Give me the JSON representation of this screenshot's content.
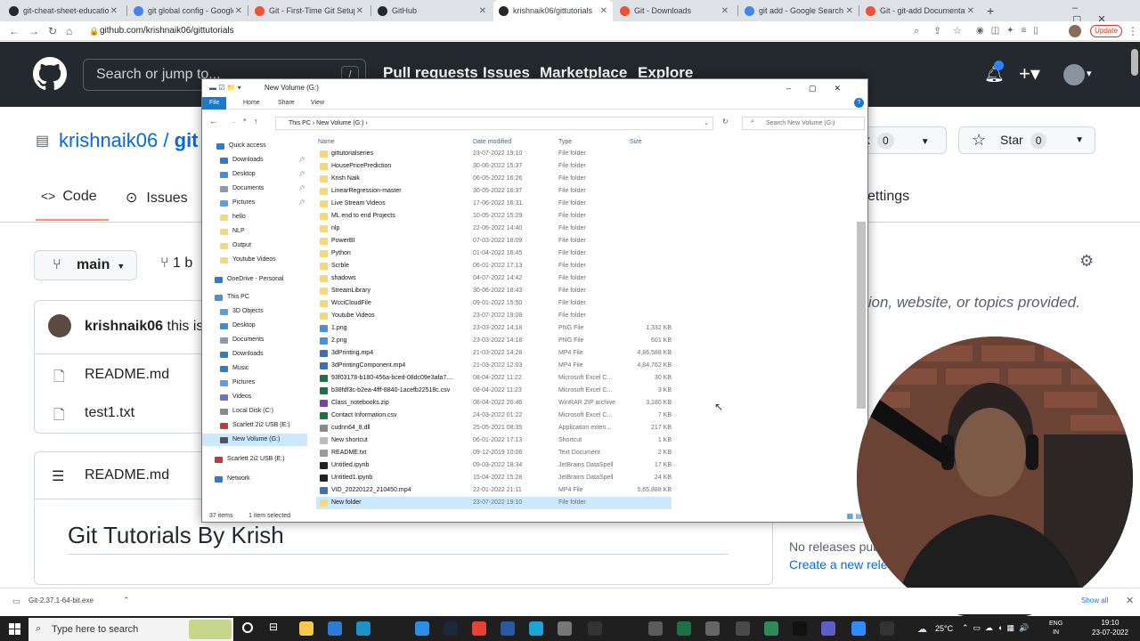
{
  "browser": {
    "tabs": [
      {
        "label": "git-cheat-sheet-education.pdf",
        "icon": "github-icon",
        "color": "#24292f"
      },
      {
        "label": "git global config - Google Search",
        "icon": "google-icon",
        "color": "#4285f4"
      },
      {
        "label": "Git - First-Time Git Setup",
        "icon": "git-icon",
        "color": "#f05133"
      },
      {
        "label": "GitHub",
        "icon": "github-icon",
        "color": "#24292f"
      },
      {
        "label": "krishnaik06/gittutorials",
        "icon": "github-icon",
        "color": "#24292f"
      },
      {
        "label": "Git - Downloads",
        "icon": "git-icon",
        "color": "#f05133"
      },
      {
        "label": "git add - Google Search",
        "icon": "google-icon",
        "color": "#4285f4"
      },
      {
        "label": "Git - git-add Documentation",
        "icon": "git-icon",
        "color": "#f05133"
      }
    ],
    "url": "github.com/krishnaik06/gittutorials",
    "update_label": "Update"
  },
  "github": {
    "search_placeholder": "Search or jump to...",
    "search_key": "/",
    "nav": [
      "Pull requests",
      "Issues",
      "Marketplace",
      "Explore"
    ],
    "owner": "krishnaik06",
    "repo_fragment": "git",
    "tabs": {
      "code": "Code",
      "issues": "Issues",
      "settings": "ettings"
    },
    "fork_fragment": "k",
    "fork_count": "0",
    "star_label": "Star",
    "star_count": "0",
    "branch": "main",
    "branch_count": "1 b",
    "commit_author": "krishnaik06",
    "commit_fragment": "this is",
    "files": [
      "README.md",
      "test1.txt"
    ],
    "readme_label": "README.md",
    "readme_heading": "Git Tutorials By Krish",
    "about_text": "tion, website, or topics provided.",
    "no_releases": "No releases pub",
    "create_release": "Create a new relea"
  },
  "explorer": {
    "title": "New Volume (G:)",
    "ribbon": [
      "File",
      "Home",
      "Share",
      "View"
    ],
    "breadcrumb": [
      "This PC",
      "New Volume (G:)"
    ],
    "search_placeholder": "Search New Volume (G:)",
    "columns": [
      "Name",
      "Date modified",
      "Type",
      "Size"
    ],
    "nav_items": [
      {
        "label": "Quick access",
        "icon": "star-icon",
        "pinned": false
      },
      {
        "label": "Downloads",
        "icon": "downloads-icon",
        "pinned": true
      },
      {
        "label": "Desktop",
        "icon": "desktop-icon",
        "pinned": true
      },
      {
        "label": "Documents",
        "icon": "documents-icon",
        "pinned": true
      },
      {
        "label": "Pictures",
        "icon": "pictures-icon",
        "pinned": true
      },
      {
        "label": "hello",
        "icon": "folder-icon",
        "pinned": false
      },
      {
        "label": "NLP",
        "icon": "folder-icon",
        "pinned": false
      },
      {
        "label": "Output",
        "icon": "folder-icon",
        "pinned": false
      },
      {
        "label": "Youtube Videos",
        "icon": "folder-icon",
        "pinned": false
      },
      {
        "label": "OneDrive - Personal",
        "icon": "cloud-icon",
        "pinned": false
      },
      {
        "label": "This PC",
        "icon": "pc-icon",
        "pinned": false
      },
      {
        "label": "3D Objects",
        "icon": "cube-icon",
        "pinned": false
      },
      {
        "label": "Desktop",
        "icon": "desktop-icon",
        "pinned": false
      },
      {
        "label": "Documents",
        "icon": "documents-icon",
        "pinned": false
      },
      {
        "label": "Downloads",
        "icon": "downloads-icon",
        "pinned": false
      },
      {
        "label": "Music",
        "icon": "music-icon",
        "pinned": false
      },
      {
        "label": "Pictures",
        "icon": "pictures-icon",
        "pinned": false
      },
      {
        "label": "Videos",
        "icon": "videos-icon",
        "pinned": false
      },
      {
        "label": "Local Disk (C:)",
        "icon": "disk-icon",
        "pinned": false
      },
      {
        "label": "Scarlett 2i2 USB (E:)",
        "icon": "usb-icon",
        "pinned": false
      },
      {
        "label": "New Volume (G:)",
        "icon": "drive-icon",
        "pinned": false
      },
      {
        "label": "Scarlett 2i2 USB (E:)",
        "icon": "usb-icon",
        "pinned": false
      },
      {
        "label": "Network",
        "icon": "network-icon",
        "pinned": false
      }
    ],
    "files": [
      {
        "name": "gittutorialseries",
        "date": "23-07-2022 19:10",
        "type": "File folder",
        "size": "",
        "icon": "folder"
      },
      {
        "name": "HousePricePrediction",
        "date": "30-06-2022 15:37",
        "type": "File folder",
        "size": "",
        "icon": "folder"
      },
      {
        "name": "Krish Naik",
        "date": "06-05-2022 16:26",
        "type": "File folder",
        "size": "",
        "icon": "folder"
      },
      {
        "name": "LinearRegression-master",
        "date": "30-05-2022 16:37",
        "type": "File folder",
        "size": "",
        "icon": "folder"
      },
      {
        "name": "Live Stream Videos",
        "date": "17-06-2022 16:31",
        "type": "File folder",
        "size": "",
        "icon": "folder"
      },
      {
        "name": "ML end to end Projects",
        "date": "10-05-2022 15:29",
        "type": "File folder",
        "size": "",
        "icon": "folder"
      },
      {
        "name": "nlp",
        "date": "22-06-2022 14:40",
        "type": "File folder",
        "size": "",
        "icon": "folder"
      },
      {
        "name": "PowerBI",
        "date": "07-03-2022 18:09",
        "type": "File folder",
        "size": "",
        "icon": "folder"
      },
      {
        "name": "Python",
        "date": "01-04-2022 16:45",
        "type": "File folder",
        "size": "",
        "icon": "folder"
      },
      {
        "name": "Scrble",
        "date": "06-01-2022 17:13",
        "type": "File folder",
        "size": "",
        "icon": "folder"
      },
      {
        "name": "shadows",
        "date": "04-07-2022 14:42",
        "type": "File folder",
        "size": "",
        "icon": "folder"
      },
      {
        "name": "StreamLibrary",
        "date": "30-06-2022 18:43",
        "type": "File folder",
        "size": "",
        "icon": "folder"
      },
      {
        "name": "WcciCloudFile",
        "date": "09-01-2022 15:50",
        "type": "File folder",
        "size": "",
        "icon": "folder"
      },
      {
        "name": "Youtube Videos",
        "date": "23-07-2022 19:08",
        "type": "File folder",
        "size": "",
        "icon": "folder"
      },
      {
        "name": "1.png",
        "date": "23-03-2022 14:18",
        "type": "PNG File",
        "size": "1,332 KB",
        "icon": "image"
      },
      {
        "name": "2.png",
        "date": "23-03-2022 14:18",
        "type": "PNG File",
        "size": "601 KB",
        "icon": "image"
      },
      {
        "name": "3dPrinting.mp4",
        "date": "21-03-2022 14:28",
        "type": "MP4 File",
        "size": "4,86,588 KB",
        "icon": "video"
      },
      {
        "name": "3dPrintingComponent.mp4",
        "date": "21-03-2022 12:03",
        "type": "MP4 File",
        "size": "4,84,762 KB",
        "icon": "video"
      },
      {
        "name": "93f03178-b180-456a-bced-08dc09e3afa7....",
        "date": "08-04-2022 11:22",
        "type": "Microsoft Excel C...",
        "size": "30 KB",
        "icon": "excel"
      },
      {
        "name": "b38fdf3c-b2ea-4fff-8840-1acefb22518c.csv",
        "date": "08-04-2022 11:23",
        "type": "Microsoft Excel C...",
        "size": "3 KB",
        "icon": "excel"
      },
      {
        "name": "Class_notebooks.zip",
        "date": "08-04-2022 20:46",
        "type": "WinRAR ZIP archive",
        "size": "3,180 KB",
        "icon": "zip"
      },
      {
        "name": "Contact Information.csv",
        "date": "24-03-2022 01:22",
        "type": "Microsoft Excel C...",
        "size": "7 KB",
        "icon": "excel"
      },
      {
        "name": "cudnn64_8.dll",
        "date": "25-05-2021 08:35",
        "type": "Application exten...",
        "size": "217 KB",
        "icon": "dll"
      },
      {
        "name": "New shortcut",
        "date": "06-01-2022 17:13",
        "type": "Shortcut",
        "size": "1 KB",
        "icon": "shortcut"
      },
      {
        "name": "README.txt",
        "date": "09-12-2019 10:06",
        "type": "Text Document",
        "size": "2 KB",
        "icon": "text"
      },
      {
        "name": "Untitled.ipynb",
        "date": "09-03-2022 18:34",
        "type": "JetBrains DataSpell",
        "size": "17 KB",
        "icon": "notebook"
      },
      {
        "name": "Untitled1.ipynb",
        "date": "15-04-2022 15:28",
        "type": "JetBrains DataSpell",
        "size": "24 KB",
        "icon": "notebook"
      },
      {
        "name": "VID_20220122_210450.mp4",
        "date": "22-01-2022 21:11",
        "type": "MP4 File",
        "size": "5,65,888 KB",
        "icon": "video"
      },
      {
        "name": "New folder",
        "date": "23-07-2022 19:10",
        "type": "File folder",
        "size": "",
        "icon": "folder",
        "selected": true
      }
    ],
    "status_items": "37 items",
    "status_selected": "1 item selected"
  },
  "downloads": {
    "file": "Git-2.37.1-64-bit.exe",
    "show_all": "Show all"
  },
  "taskbar": {
    "search_placeholder": "Type here to search",
    "temperature": "25°C",
    "lang": "ENG",
    "region": "IN",
    "time": "19:10",
    "date": "23-07-2022"
  },
  "colors": {
    "gh_header": "#24292f",
    "link": "#0969da",
    "folder": "#f8d775",
    "selection": "#cce8ff",
    "ribbon_file": "#1979ca"
  }
}
